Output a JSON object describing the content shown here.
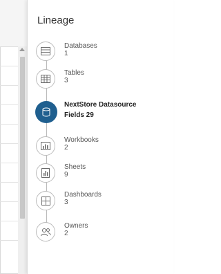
{
  "panel": {
    "title": "Lineage",
    "items": [
      {
        "category": "Databases",
        "count": "1",
        "icon": "database-icon",
        "active": false
      },
      {
        "category": "Tables",
        "count": "3",
        "icon": "table-icon",
        "active": false
      },
      {
        "category": "NextStore Datasource",
        "count": "Fields 29",
        "icon": "datasource-icon",
        "active": true
      },
      {
        "category": "Workbooks",
        "count": "2",
        "icon": "workbook-icon",
        "active": false
      },
      {
        "category": "Sheets",
        "count": "9",
        "icon": "sheet-icon",
        "active": false
      },
      {
        "category": "Dashboards",
        "count": "3",
        "icon": "dashboard-icon",
        "active": false
      },
      {
        "category": "Owners",
        "count": "2",
        "icon": "owners-icon",
        "active": false
      }
    ]
  },
  "colors": {
    "active_node": "#1f5f8f",
    "rail": "#b9b9b9",
    "node_border": "#bdbdbd"
  }
}
